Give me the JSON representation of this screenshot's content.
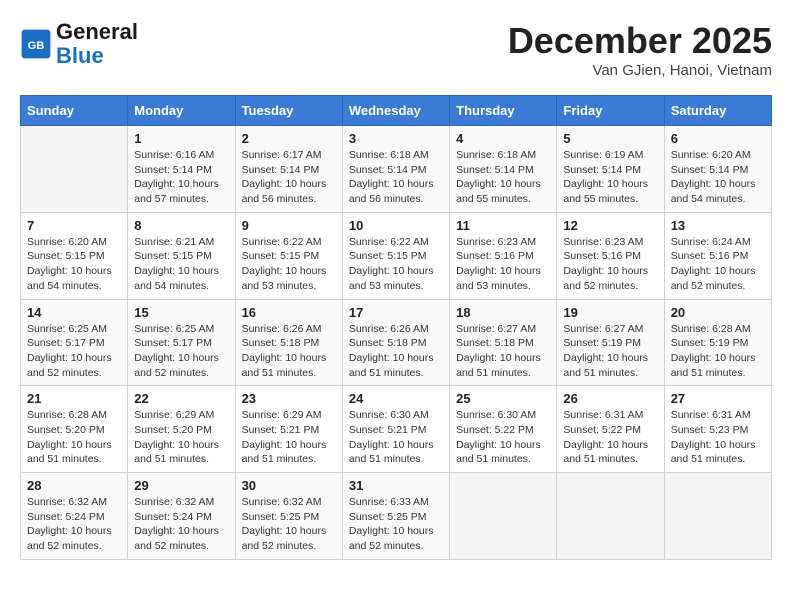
{
  "header": {
    "logo_line1": "General",
    "logo_line2": "Blue",
    "month": "December 2025",
    "location": "Van GJien, Hanoi, Vietnam"
  },
  "weekdays": [
    "Sunday",
    "Monday",
    "Tuesday",
    "Wednesday",
    "Thursday",
    "Friday",
    "Saturday"
  ],
  "weeks": [
    [
      {
        "day": "",
        "text": ""
      },
      {
        "day": "1",
        "text": "Sunrise: 6:16 AM\nSunset: 5:14 PM\nDaylight: 10 hours and 57 minutes."
      },
      {
        "day": "2",
        "text": "Sunrise: 6:17 AM\nSunset: 5:14 PM\nDaylight: 10 hours and 56 minutes."
      },
      {
        "day": "3",
        "text": "Sunrise: 6:18 AM\nSunset: 5:14 PM\nDaylight: 10 hours and 56 minutes."
      },
      {
        "day": "4",
        "text": "Sunrise: 6:18 AM\nSunset: 5:14 PM\nDaylight: 10 hours and 55 minutes."
      },
      {
        "day": "5",
        "text": "Sunrise: 6:19 AM\nSunset: 5:14 PM\nDaylight: 10 hours and 55 minutes."
      },
      {
        "day": "6",
        "text": "Sunrise: 6:20 AM\nSunset: 5:14 PM\nDaylight: 10 hours and 54 minutes."
      }
    ],
    [
      {
        "day": "7",
        "text": "Sunrise: 6:20 AM\nSunset: 5:15 PM\nDaylight: 10 hours and 54 minutes."
      },
      {
        "day": "8",
        "text": "Sunrise: 6:21 AM\nSunset: 5:15 PM\nDaylight: 10 hours and 54 minutes."
      },
      {
        "day": "9",
        "text": "Sunrise: 6:22 AM\nSunset: 5:15 PM\nDaylight: 10 hours and 53 minutes."
      },
      {
        "day": "10",
        "text": "Sunrise: 6:22 AM\nSunset: 5:15 PM\nDaylight: 10 hours and 53 minutes."
      },
      {
        "day": "11",
        "text": "Sunrise: 6:23 AM\nSunset: 5:16 PM\nDaylight: 10 hours and 53 minutes."
      },
      {
        "day": "12",
        "text": "Sunrise: 6:23 AM\nSunset: 5:16 PM\nDaylight: 10 hours and 52 minutes."
      },
      {
        "day": "13",
        "text": "Sunrise: 6:24 AM\nSunset: 5:16 PM\nDaylight: 10 hours and 52 minutes."
      }
    ],
    [
      {
        "day": "14",
        "text": "Sunrise: 6:25 AM\nSunset: 5:17 PM\nDaylight: 10 hours and 52 minutes."
      },
      {
        "day": "15",
        "text": "Sunrise: 6:25 AM\nSunset: 5:17 PM\nDaylight: 10 hours and 52 minutes."
      },
      {
        "day": "16",
        "text": "Sunrise: 6:26 AM\nSunset: 5:18 PM\nDaylight: 10 hours and 51 minutes."
      },
      {
        "day": "17",
        "text": "Sunrise: 6:26 AM\nSunset: 5:18 PM\nDaylight: 10 hours and 51 minutes."
      },
      {
        "day": "18",
        "text": "Sunrise: 6:27 AM\nSunset: 5:18 PM\nDaylight: 10 hours and 51 minutes."
      },
      {
        "day": "19",
        "text": "Sunrise: 6:27 AM\nSunset: 5:19 PM\nDaylight: 10 hours and 51 minutes."
      },
      {
        "day": "20",
        "text": "Sunrise: 6:28 AM\nSunset: 5:19 PM\nDaylight: 10 hours and 51 minutes."
      }
    ],
    [
      {
        "day": "21",
        "text": "Sunrise: 6:28 AM\nSunset: 5:20 PM\nDaylight: 10 hours and 51 minutes."
      },
      {
        "day": "22",
        "text": "Sunrise: 6:29 AM\nSunset: 5:20 PM\nDaylight: 10 hours and 51 minutes."
      },
      {
        "day": "23",
        "text": "Sunrise: 6:29 AM\nSunset: 5:21 PM\nDaylight: 10 hours and 51 minutes."
      },
      {
        "day": "24",
        "text": "Sunrise: 6:30 AM\nSunset: 5:21 PM\nDaylight: 10 hours and 51 minutes."
      },
      {
        "day": "25",
        "text": "Sunrise: 6:30 AM\nSunset: 5:22 PM\nDaylight: 10 hours and 51 minutes."
      },
      {
        "day": "26",
        "text": "Sunrise: 6:31 AM\nSunset: 5:22 PM\nDaylight: 10 hours and 51 minutes."
      },
      {
        "day": "27",
        "text": "Sunrise: 6:31 AM\nSunset: 5:23 PM\nDaylight: 10 hours and 51 minutes."
      }
    ],
    [
      {
        "day": "28",
        "text": "Sunrise: 6:32 AM\nSunset: 5:24 PM\nDaylight: 10 hours and 52 minutes."
      },
      {
        "day": "29",
        "text": "Sunrise: 6:32 AM\nSunset: 5:24 PM\nDaylight: 10 hours and 52 minutes."
      },
      {
        "day": "30",
        "text": "Sunrise: 6:32 AM\nSunset: 5:25 PM\nDaylight: 10 hours and 52 minutes."
      },
      {
        "day": "31",
        "text": "Sunrise: 6:33 AM\nSunset: 5:25 PM\nDaylight: 10 hours and 52 minutes."
      },
      {
        "day": "",
        "text": ""
      },
      {
        "day": "",
        "text": ""
      },
      {
        "day": "",
        "text": ""
      }
    ]
  ]
}
